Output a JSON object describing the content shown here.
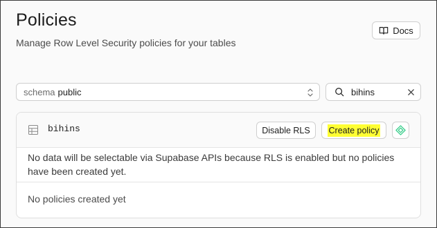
{
  "header": {
    "title": "Policies",
    "subtitle": "Manage Row Level Security policies for your tables",
    "docs_label": "Docs",
    "docs_icon": "book-open-icon"
  },
  "filters": {
    "schema_label": "schema",
    "schema_value": "public",
    "search_value": "bihins",
    "search_icon": "search-icon",
    "clear_icon": "close-icon"
  },
  "table_card": {
    "table_icon": "table-grid-icon",
    "table_name": "bihins",
    "disable_rls_label": "Disable RLS",
    "create_policy_label": "Create policy",
    "create_policy_highlight": "#ffff33",
    "ai_icon": "assistant-diamond-icon",
    "ai_icon_color": "#3ecf8e",
    "warning_text": "No data will be selectable via Supabase APIs because RLS is enabled but no policies have been created yet.",
    "empty_text": "No policies created yet"
  }
}
